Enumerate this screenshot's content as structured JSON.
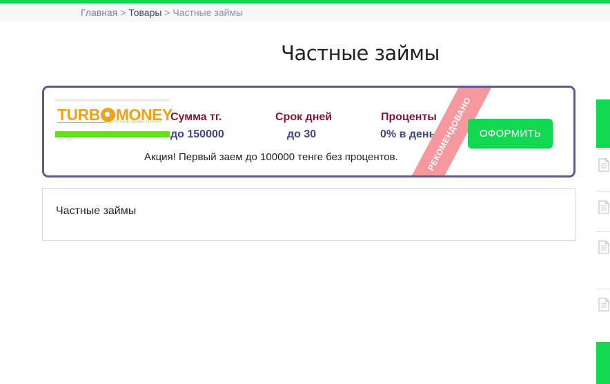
{
  "breadcrumb": {
    "home": "Главная",
    "sep1": ">",
    "products": "Товары",
    "sep2": ">",
    "current": "Частные займы"
  },
  "page": {
    "title": "Частные займы"
  },
  "offer": {
    "logo": {
      "text_left": "TURB",
      "text_right": "MONEY",
      "tagline": "СРОЧНЫЕ ЗАЙМЫ ОНЛАЙН"
    },
    "columns": [
      {
        "label": "Сумма тг.",
        "value": "до 150000"
      },
      {
        "label": "Срок дней",
        "value": "до 30"
      },
      {
        "label": "Проценты",
        "value": "0% в день"
      }
    ],
    "promo": "Акция! Первый заем до 100000 тенге без процентов.",
    "ribbon": "РЕКОМЕНДОВАНО",
    "button": "ОФОРМИТЬ"
  },
  "content": {
    "title": "Частные займы"
  },
  "sidebar": {
    "icons": [
      "document-icon",
      "document-icon",
      "document-icon",
      "document-icon"
    ]
  },
  "colors": {
    "accent": "#10d84f",
    "border": "#5a5b8c",
    "label": "#8a1235",
    "value": "#3d4686",
    "ribbon": "#f6999f"
  }
}
